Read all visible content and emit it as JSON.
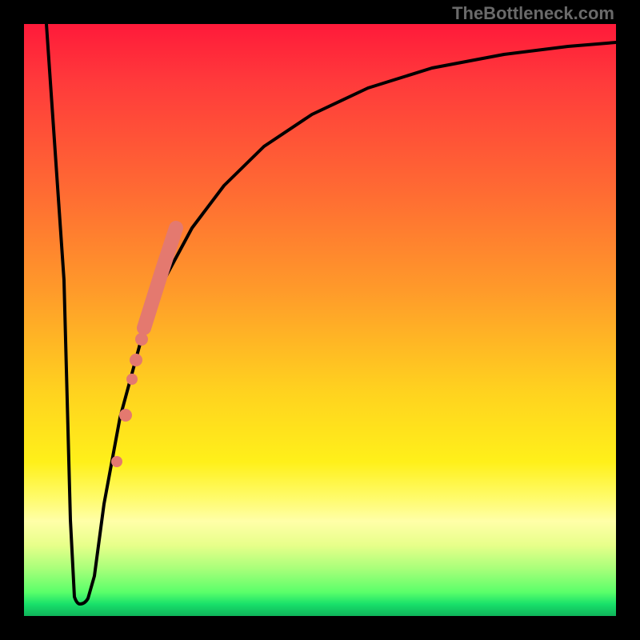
{
  "watermark": "TheBottleneck.com",
  "chart_data": {
    "type": "line",
    "title": "",
    "xlabel": "",
    "ylabel": "",
    "xlim": [
      0,
      100
    ],
    "ylim": [
      0,
      100
    ],
    "grid": false,
    "legend": false,
    "series": [
      {
        "name": "bottleneck-curve",
        "x": [
          0,
          4,
          8,
          9,
          10,
          12,
          14,
          17,
          20,
          25,
          30,
          35,
          40,
          48,
          56,
          68,
          80,
          92,
          100
        ],
        "y": [
          100,
          55,
          5,
          2,
          2,
          7,
          20,
          35,
          48,
          60,
          69,
          75,
          80,
          85,
          88,
          91,
          93,
          94.5,
          95
        ]
      }
    ],
    "highlight_points": {
      "name": "pink-markers",
      "color": "#e4796f",
      "points": [
        {
          "x": 17.5,
          "y": 24,
          "r": 6
        },
        {
          "x": 18.8,
          "y": 33,
          "r": 6
        },
        {
          "x": 19.8,
          "y": 39,
          "r": 6
        },
        {
          "x": 21.5,
          "y": 48,
          "r": 7
        },
        {
          "x": 23.2,
          "y": 55,
          "r": 7
        }
      ]
    }
  }
}
